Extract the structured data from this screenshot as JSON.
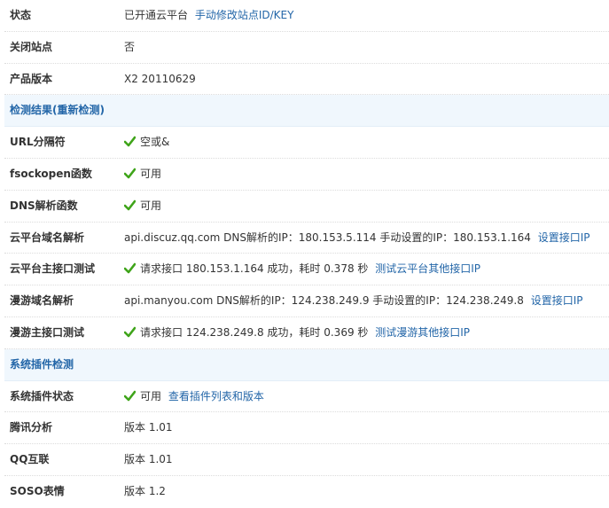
{
  "rows_top": [
    {
      "label": "状态",
      "text": "已开通云平台",
      "link": "手动修改站点ID/KEY"
    },
    {
      "label": "关闭站点",
      "text": "否"
    },
    {
      "label": "产品版本",
      "text": "X2 20110629"
    }
  ],
  "section_detect": {
    "title": "检测结果(重新检测)"
  },
  "detect_rows": [
    {
      "label": "URL分隔符",
      "text": "空或&"
    },
    {
      "label": "fsockopen函数",
      "text": "可用"
    },
    {
      "label": "DNS解析函数",
      "text": "可用"
    },
    {
      "label": "云平台域名解析",
      "text": "api.discuz.qq.com DNS解析的IP：180.153.5.114 手动设置的IP：180.153.1.164",
      "link": "设置接口IP"
    },
    {
      "label": "云平台主接口测试",
      "text": "请求接口  180.153.1.164 成功，耗时  0.378 秒",
      "link": "测试云平台其他接口IP"
    },
    {
      "label": "漫游域名解析",
      "text": "api.manyou.com DNS解析的IP：124.238.249.9 手动设置的IP：124.238.249.8",
      "link": "设置接口IP"
    },
    {
      "label": "漫游主接口测试",
      "text": "请求接口  124.238.249.8 成功，耗时  0.369 秒",
      "link": "测试漫游其他接口IP"
    }
  ],
  "section_plugin": {
    "title": "系统插件检测"
  },
  "plugin_rows": [
    {
      "label": "系统插件状态",
      "text": "可用",
      "link": "查看插件列表和版本"
    },
    {
      "label": "腾讯分析",
      "text": "版本  1.01"
    },
    {
      "label": "QQ互联",
      "text": "版本  1.01"
    },
    {
      "label": "SOSO表情",
      "text": "版本  1.2"
    }
  ],
  "colors": {
    "link": "#2366a8",
    "section_bg": "#f0f7fd",
    "check": "#3fa41a"
  },
  "icons": {
    "check": "check-icon"
  }
}
